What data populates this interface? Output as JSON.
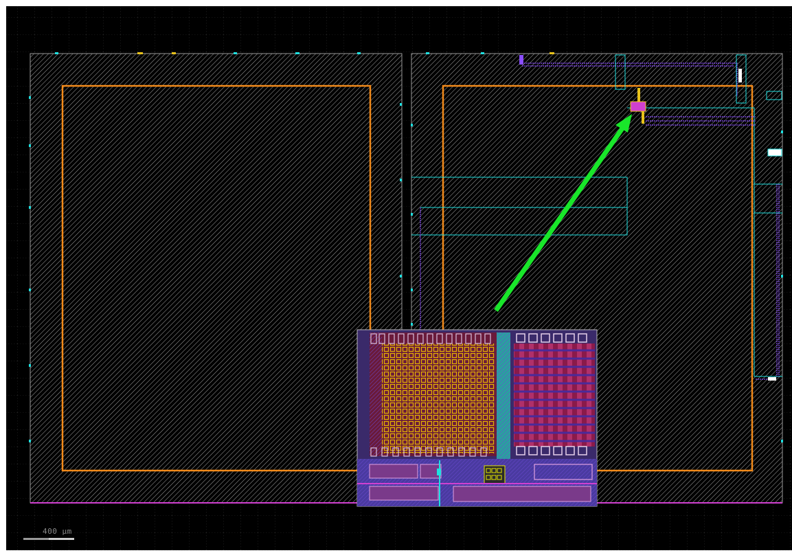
{
  "scale_bar": {
    "label": "400 µm"
  },
  "colors": {
    "background": "#000000",
    "canvas_border": "#ffffff",
    "grid_dots": "#3a3a3a",
    "hatch": "#bfbfbf",
    "die_outline": "#f28a1a",
    "metal_cyan": "#1ee0e0",
    "metal_purple": "#8a4dff",
    "pad_magenta": "#d040d0",
    "arrow": "#19e62a",
    "via_yellow": "#e8c21a"
  },
  "layout": {
    "dies": [
      {
        "name": "die-left",
        "has_routing": false
      },
      {
        "name": "die-right",
        "has_routing": true
      }
    ],
    "callout": {
      "name": "zoom-inset",
      "target": "cell-block",
      "arrow_icon": "pointer-arrow-icon"
    }
  }
}
